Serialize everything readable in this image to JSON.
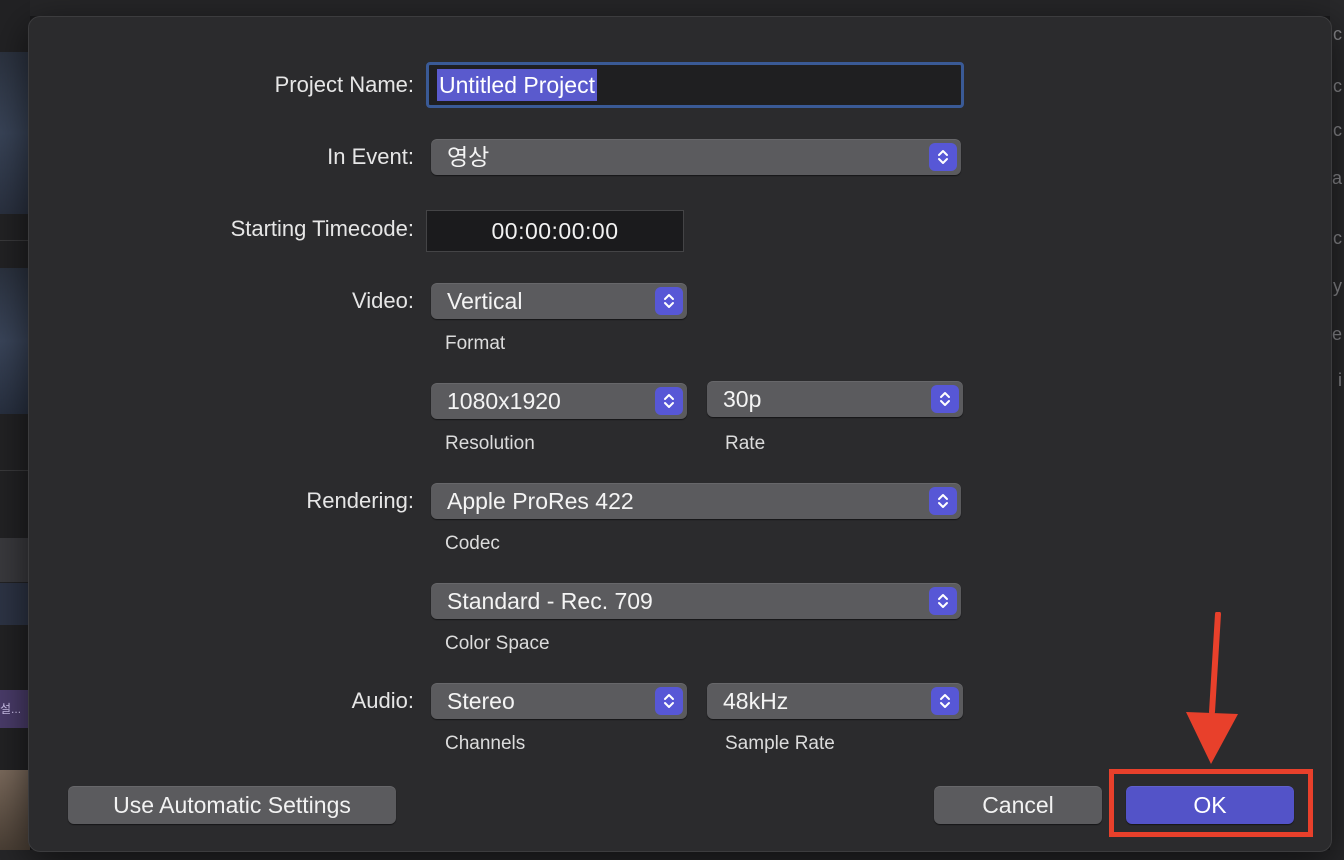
{
  "dialog": {
    "project_name_label": "Project Name:",
    "project_name_value": "Untitled Project",
    "in_event_label": "In Event:",
    "in_event_value": "영상",
    "starting_timecode_label": "Starting Timecode:",
    "starting_timecode_value": "00:00:00:00",
    "video_label": "Video:",
    "video_format_value": "Vertical",
    "video_format_caption": "Format",
    "resolution_value": "1080x1920",
    "resolution_caption": "Resolution",
    "rate_value": "30p",
    "rate_caption": "Rate",
    "rendering_label": "Rendering:",
    "codec_value": "Apple ProRes 422",
    "codec_caption": "Codec",
    "color_space_value": "Standard - Rec. 709",
    "color_space_caption": "Color Space",
    "audio_label": "Audio:",
    "channels_value": "Stereo",
    "channels_caption": "Channels",
    "sample_rate_value": "48kHz",
    "sample_rate_caption": "Sample Rate",
    "automatic_button": "Use Automatic Settings",
    "cancel_button": "Cancel",
    "ok_button": "OK"
  },
  "background": {
    "left_clip_label": "설...",
    "right_edge_letters": [
      "c",
      "c",
      "c",
      "a",
      "c",
      "y",
      "e",
      "i"
    ]
  },
  "colors": {
    "accent": "#5353c8",
    "annotation": "#e8402b",
    "focus_ring": "#3a5a96"
  },
  "icons": {
    "popup_stepper": "up-down-chevron-icon",
    "annotation_arrow": "arrow-down-icon"
  }
}
